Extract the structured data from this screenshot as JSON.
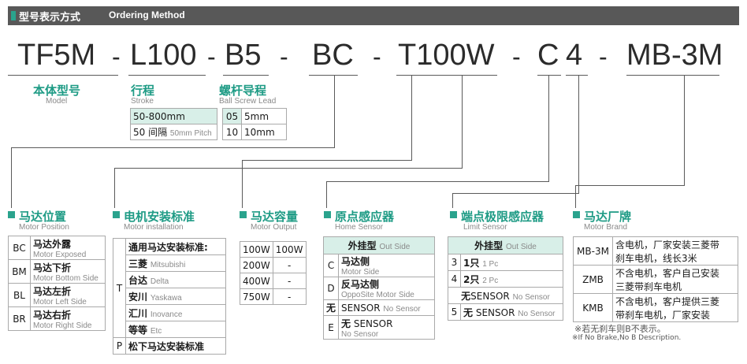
{
  "header": {
    "title_cn": "型号表示方式",
    "title_en": "Ordering Method"
  },
  "code": {
    "parts": [
      "TF5M",
      "L100",
      "B5",
      "BC",
      "T100W",
      "C",
      "4",
      "MB-3M"
    ],
    "dash": "-"
  },
  "model": {
    "cn": "本体型号",
    "en": "Model"
  },
  "stroke": {
    "cn": "行程",
    "en": "Stroke",
    "rows": [
      {
        "text": "50-800mm"
      },
      {
        "text": "50 间隔",
        "sub": "50mm Pitch"
      }
    ]
  },
  "lead": {
    "cn": "螺杆导程",
    "en": "Ball Screw Lead",
    "rows": [
      {
        "key": "05",
        "val": "5mm"
      },
      {
        "key": "10",
        "val": "10mm"
      }
    ]
  },
  "position": {
    "cn": "马达位置",
    "en": "Motor Position",
    "rows": [
      {
        "key": "BC",
        "cn": "马达外露",
        "en": "Motor Exposed"
      },
      {
        "key": "BM",
        "cn": "马达下折",
        "en": "Motor Bottom Side"
      },
      {
        "key": "BL",
        "cn": "马达左折",
        "en": "Motor Left Side"
      },
      {
        "key": "BR",
        "cn": "马达右折",
        "en": "Motor Right Side"
      }
    ]
  },
  "mounting": {
    "cn": "电机安装标准",
    "en": "Motor installation",
    "t_key": "T",
    "t_head": "通用马达安装标准:",
    "brands": [
      {
        "cn": "三菱",
        "en": "Mitsubishi"
      },
      {
        "cn": "台达",
        "en": "Delta"
      },
      {
        "cn": "安川",
        "en": "Yaskawa"
      },
      {
        "cn": "汇川",
        "en": "Inovance"
      },
      {
        "cn": "等等",
        "en": "Etc"
      }
    ],
    "p_key": "P",
    "p_text": "松下马达安装标准"
  },
  "output": {
    "cn": "马达容量",
    "en": "Motor Output",
    "rows": [
      {
        "key": "100W",
        "val": "100W"
      },
      {
        "key": "200W",
        "val": "-"
      },
      {
        "key": "400W",
        "val": "-"
      },
      {
        "key": "750W",
        "val": "-"
      }
    ]
  },
  "home": {
    "cn": "原点感应器",
    "en": "Home Sensor",
    "head_cn": "外挂型",
    "head_en": "Out Side",
    "rows": [
      {
        "key": "C",
        "cn": "马达侧",
        "en": "Motor Side"
      },
      {
        "key": "D",
        "cn": "反马达侧",
        "en": "OppoSite Motor Side"
      }
    ],
    "none_key": "无",
    "none_cn": "SENSOR",
    "none_en": "No Sensor",
    "e_key": "E",
    "e_cn": "无",
    "e_cn2": "SENSOR",
    "e_en": "No Sensor"
  },
  "limit": {
    "cn": "端点极限感应器",
    "en": "Limit Sensor",
    "head_cn": "外挂型",
    "head_en": "Out Side",
    "rows": [
      {
        "key": "3",
        "cn": "1只",
        "en": "1 Pc"
      },
      {
        "key": "4",
        "cn": "2只",
        "en": "2 Pc"
      }
    ],
    "none_cn": "无",
    "none_mid": "SENSOR",
    "none_en": "No Sensor",
    "five_key": "5",
    "five_cn": "无",
    "five_mid": "SENSOR",
    "five_en": "No Sensor"
  },
  "brand": {
    "cn": "马达厂牌",
    "en": "Motor Brand",
    "rows": [
      {
        "key": "MB-3M",
        "l1": "含电机，厂家安装三菱带",
        "l2": "刹车电机，线长3米"
      },
      {
        "key": "ZMB",
        "l1": "不含电机，客户自己安装",
        "l2": "三菱带刹车电机"
      },
      {
        "key": "KMB",
        "l1": "不含电机，客户提供三菱",
        "l2": "带刹车电机，厂家安装"
      }
    ],
    "note_cn": "※若无刹车则B不表示。",
    "note_en": "※If No Brake,No B Description."
  },
  "colors": {
    "accent": "#1e9b85",
    "header": "#585858",
    "table_head": "#d8efe8"
  }
}
